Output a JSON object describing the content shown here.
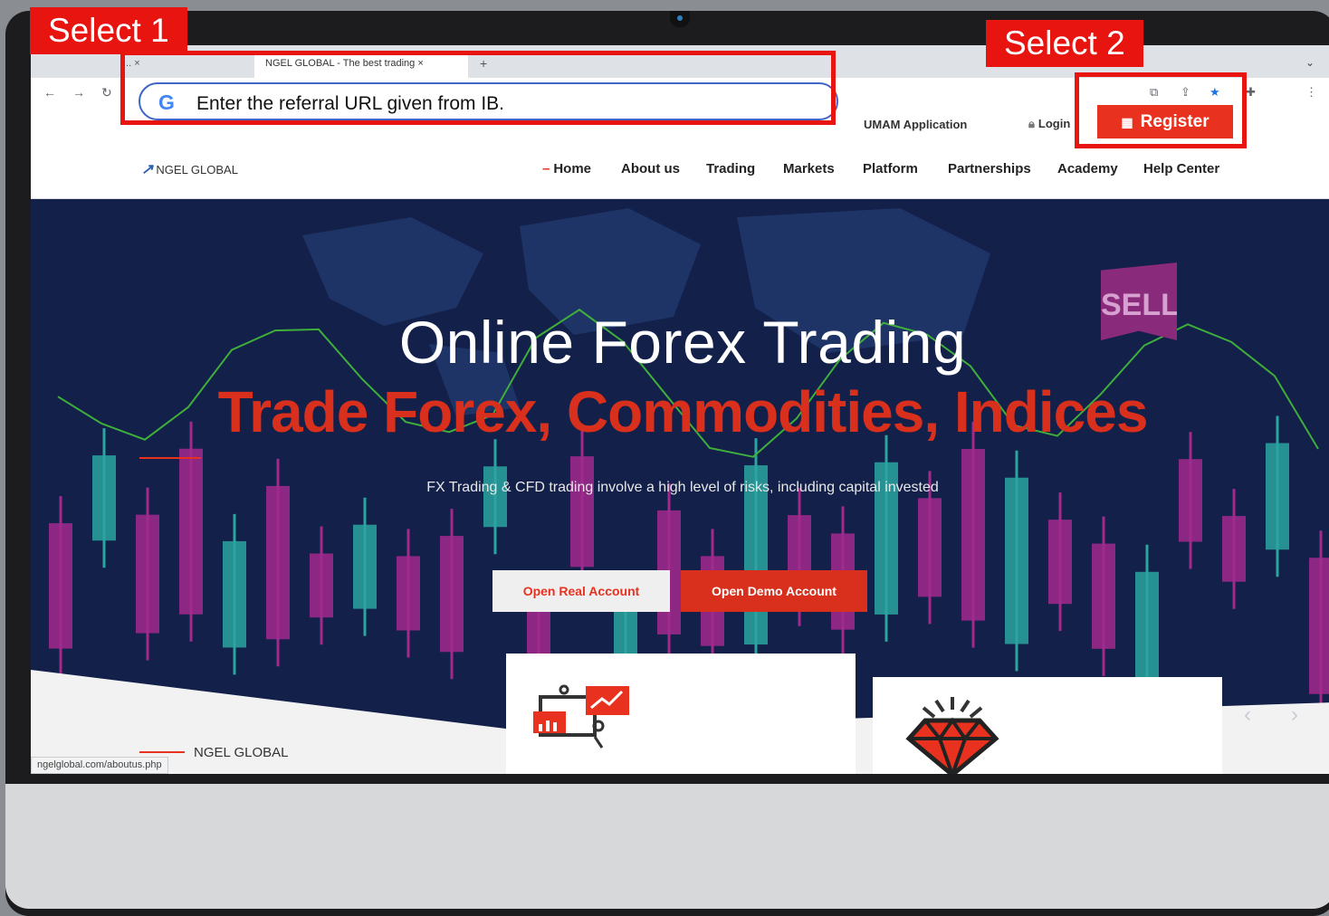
{
  "browser": {
    "tabs": [
      {
        "label": "... ×"
      },
      {
        "label": "NGEL GLOBAL - The best trading ×"
      }
    ],
    "new_tab": "+",
    "address_text": "Enter the referral URL given from IB.",
    "status_url": "ngelglobal.com/aboutus.php"
  },
  "topbar": {
    "umam_label": "UMAM Application",
    "login_label": "Login",
    "register_label": "Register"
  },
  "brand": {
    "name": "NGEL GLOBAL"
  },
  "nav": {
    "items": [
      {
        "label": "Home"
      },
      {
        "label": "About us"
      },
      {
        "label": "Trading"
      },
      {
        "label": "Markets"
      },
      {
        "label": "Platform"
      },
      {
        "label": "Partnerships"
      },
      {
        "label": "Academy"
      },
      {
        "label": "Help Center"
      }
    ]
  },
  "hero": {
    "title": "Online Forex Trading",
    "subtitle": "Trade Forex, Commodities, Indices",
    "note": "FX Trading & CFD trading involve a high level of risks, including capital invested",
    "sell_badge": "SELL",
    "btn_real": "Open Real Account",
    "btn_demo": "Open Demo Account"
  },
  "section": {
    "label": "NGEL GLOBAL"
  },
  "annotations": {
    "select1": "Select 1",
    "select2": "Select 2"
  },
  "colors": {
    "accent": "#e8321f",
    "annotation": "#e8140f",
    "hero_bg": "#12204a",
    "candle_teal": "#2aa5a0",
    "candle_magenta": "#a22a8e"
  }
}
